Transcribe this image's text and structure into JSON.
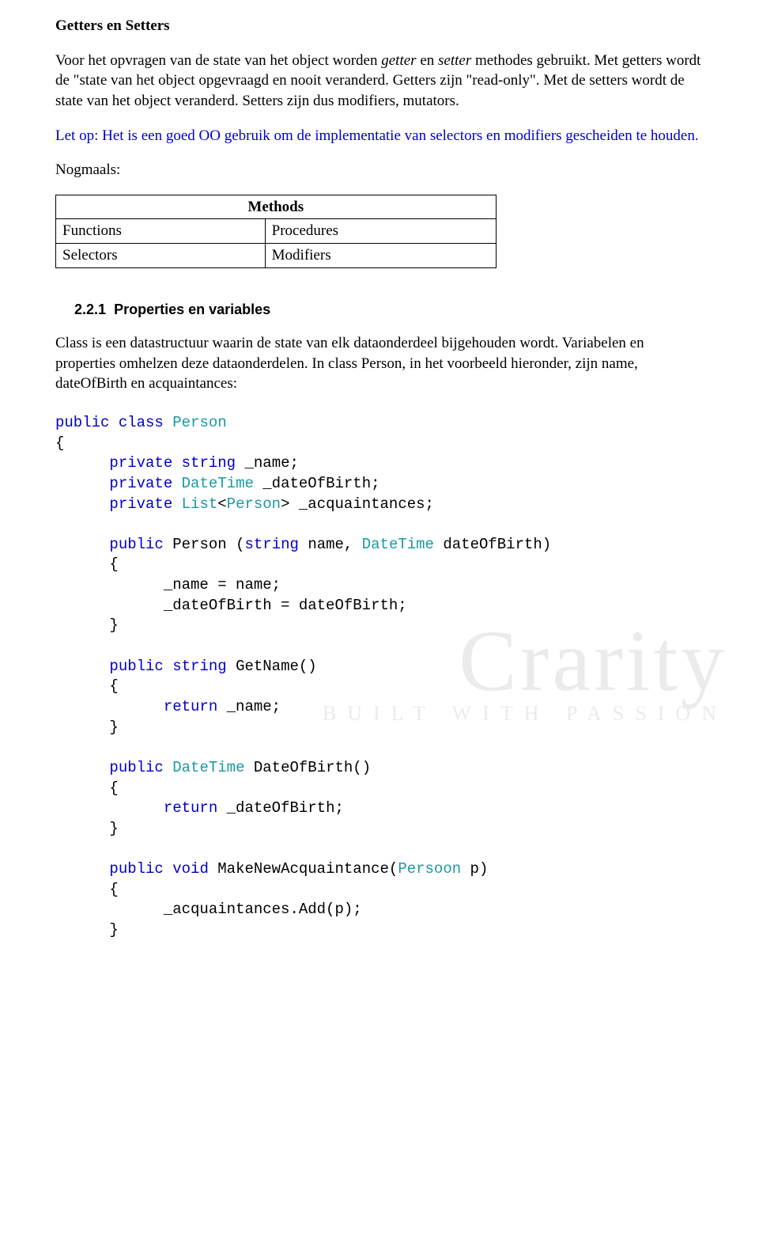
{
  "title": "Getters en Setters",
  "para1_a": "Voor het opvragen van de state van het object worden ",
  "para1_i1": "getter",
  "para1_b": " en ",
  "para1_i2": "setter",
  "para1_c": " methodes gebruikt. Met getters wordt de \"state van het object opgevraagd en nooit veranderd. Getters zijn \"read-only\". Met de setters wordt de state van het object veranderd. Setters zijn dus modifiers, mutators.",
  "note": "Let op: Het is een goed OO gebruik om de implementatie van selectors en modifiers gescheiden te houden.",
  "nogmaals": "Nogmaals:",
  "table": {
    "header": "Methods",
    "r1c1": "Functions",
    "r1c2": "Procedures",
    "r2c1": "Selectors",
    "r2c2": "Modifiers"
  },
  "subsection_num": "2.2.1",
  "subsection_title": "Properties en variables",
  "para2": "Class is een datastructuur waarin de state van elk dataonderdeel bijgehouden wordt. Variabelen en properties omhelzen deze dataonderdelen. In class Person, in het voorbeeld hieronder, zijn name, dateOfBirth en acquaintances:",
  "watermark_big": "Crarity",
  "watermark_small": "BUILT WITH PASSION",
  "code": {
    "kw_public": "public",
    "kw_class": "class",
    "kw_private": "private",
    "kw_string": "string",
    "kw_return": "return",
    "kw_void": "void",
    "t_Person": "Person",
    "t_DateTime": "DateTime",
    "t_List": "List",
    "t_Persoon": "Persoon",
    "f_name": "_name",
    "f_dob": "_dateOfBirth",
    "f_acq": "_acquaintances",
    "p_name": "name",
    "p_dob": "dateOfBirth",
    "m_GetName": "GetName",
    "m_DateOfBirth": "DateOfBirth",
    "m_MakeNew": "MakeNewAcquaintance",
    "p_p": "p",
    "m_Add": "Add",
    "brace_o": "{",
    "brace_c": "}",
    "assign1": "_name = name;",
    "assign2": "_dateOfBirth = dateOfBirth;",
    "ret1": " _name;",
    "ret2": " _dateOfBirth;",
    "addcall": "_acquaintances.Add(p);"
  }
}
